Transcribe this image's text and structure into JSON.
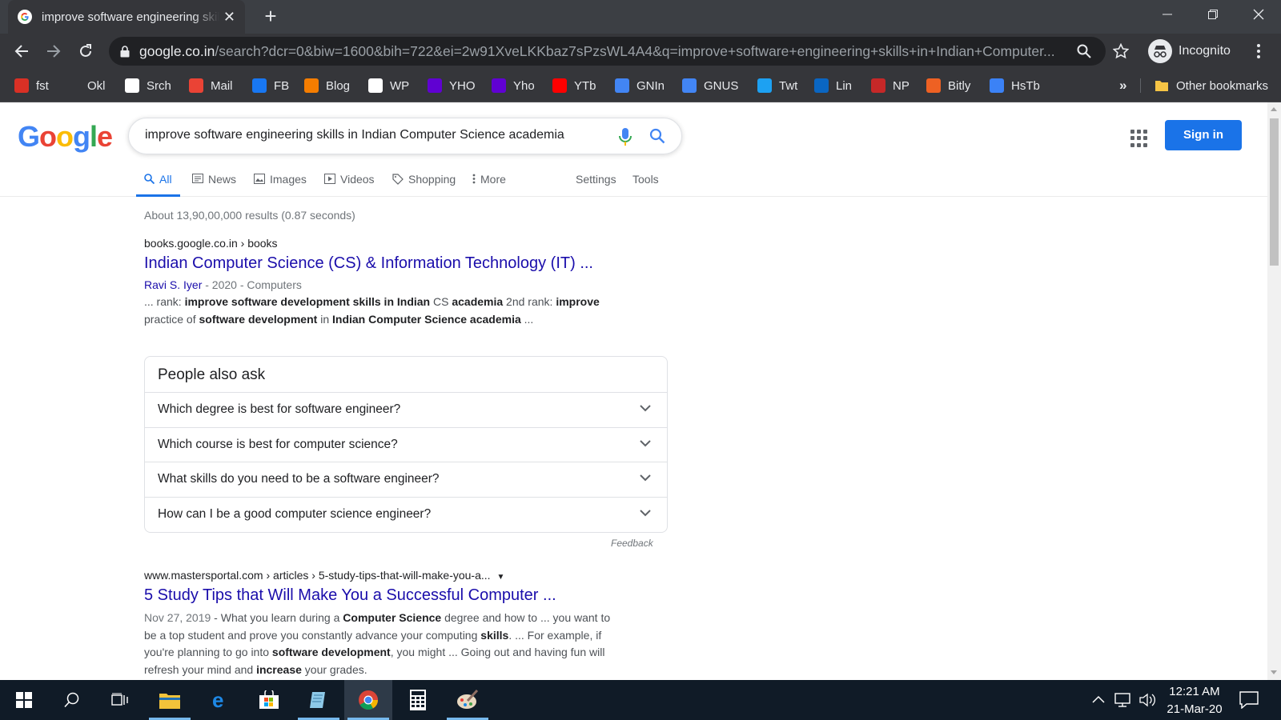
{
  "browser": {
    "tab_title": "improve software engineering skills in Indian Computer Science academia",
    "url_host": "google.co.in",
    "url_path": "/search?dcr=0&biw=1600&bih=722&ei=2w91XveLKKbaz7sPzsWL4A4&q=improve+software+engineering+skills+in+Indian+Computer...",
    "profile_label": "Incognito",
    "bookmarks": [
      {
        "label": "fst",
        "icon": "gauge-icon",
        "color": "#d93025"
      },
      {
        "label": "Okl",
        "icon": "blank-icon",
        "color": "#35363a"
      },
      {
        "label": "Srch",
        "icon": "google-icon",
        "color": "#ffffff"
      },
      {
        "label": "Mail",
        "icon": "gmail-icon",
        "color": "#ea4335"
      },
      {
        "label": "FB",
        "icon": "facebook-icon",
        "color": "#1877f2"
      },
      {
        "label": "Blog",
        "icon": "blogger-icon",
        "color": "#f57d00"
      },
      {
        "label": "WP",
        "icon": "wordpress-icon",
        "color": "#ffffff"
      },
      {
        "label": "YHO",
        "icon": "yahoo-icon",
        "color": "#6001d2"
      },
      {
        "label": "Yho",
        "icon": "yahoo-icon",
        "color": "#6001d2"
      },
      {
        "label": "YTb",
        "icon": "youtube-icon",
        "color": "#ff0000"
      },
      {
        "label": "GNIn",
        "icon": "google-news-icon",
        "color": "#4285f4"
      },
      {
        "label": "GNUS",
        "icon": "google-news-icon",
        "color": "#4285f4"
      },
      {
        "label": "Twt",
        "icon": "twitter-icon",
        "color": "#1da1f2"
      },
      {
        "label": "Lin",
        "icon": "linkedin-icon",
        "color": "#0a66c2"
      },
      {
        "label": "NP",
        "icon": "newspaper-icon",
        "color": "#c62828"
      },
      {
        "label": "Bitly",
        "icon": "bitly-icon",
        "color": "#ee6123"
      },
      {
        "label": "HsTb",
        "icon": "hashtag-icon",
        "color": "#3b82f6"
      }
    ],
    "overflow_label": "»",
    "other_bookmarks_label": "Other bookmarks"
  },
  "google": {
    "logo_text": "Google",
    "query": "improve software engineering skills in Indian Computer Science academia",
    "sign_in_label": "Sign in",
    "tabs": [
      {
        "label": "All",
        "icon": "search-icon"
      },
      {
        "label": "News",
        "icon": "news-icon"
      },
      {
        "label": "Images",
        "icon": "image-icon"
      },
      {
        "label": "Videos",
        "icon": "video-icon"
      },
      {
        "label": "Shopping",
        "icon": "tag-icon"
      },
      {
        "label": "More",
        "icon": "more-vert-icon"
      }
    ],
    "settings_label": "Settings",
    "tools_label": "Tools",
    "stats": "About 13,90,00,000 results (0.87 seconds)",
    "result1": {
      "cite": "books.google.co.in › books",
      "title": "Indian Computer Science (CS) & Information Technology (IT) ...",
      "author": "Ravi S. Iyer",
      "meta": " - 2020 - Computers",
      "snippet_line1": [
        {
          "t": "... rank: ",
          "b": false
        },
        {
          "t": "improve software development skills in Indian",
          "b": true
        },
        {
          "t": " CS ",
          "b": false
        },
        {
          "t": "academia",
          "b": true
        },
        {
          "t": " 2nd rank: ",
          "b": false
        },
        {
          "t": "improve",
          "b": true
        }
      ],
      "snippet_line2": [
        {
          "t": "practice of ",
          "b": false
        },
        {
          "t": "software development",
          "b": true
        },
        {
          "t": " in ",
          "b": false
        },
        {
          "t": "Indian Computer Science academia",
          "b": true
        },
        {
          "t": " ...",
          "b": false
        }
      ]
    },
    "people_also_ask": {
      "title": "People also ask",
      "questions": [
        "Which degree is best for software engineer?",
        "Which course is best for computer science?",
        "What skills do you need to be a software engineer?",
        "How can I be a good computer science engineer?"
      ],
      "feedback": "Feedback"
    },
    "result2": {
      "cite": "www.mastersportal.com › articles › 5-study-tips-that-will-make-you-a...",
      "cite_dropdown": "▼",
      "title": "5 Study Tips that Will Make You a Successful Computer ...",
      "date": "Nov 27, 2019",
      "snippet": [
        {
          "t": " - What you learn during a ",
          "b": false
        },
        {
          "t": "Computer Science",
          "b": true
        },
        {
          "t": " degree and how to ... you want to be a top student and prove you constantly advance your computing ",
          "b": false
        },
        {
          "t": "skills",
          "b": true
        },
        {
          "t": ". ... For example, if you're planning to go into ",
          "b": false
        },
        {
          "t": "software development",
          "b": true
        },
        {
          "t": ", you might ... Going out and having fun will refresh your mind and ",
          "b": false
        },
        {
          "t": "increase",
          "b": true
        },
        {
          "t": " your grades.",
          "b": false
        }
      ]
    }
  },
  "taskbar": {
    "time": "12:21 AM",
    "date": "21-Mar-20",
    "apps": [
      "start-icon",
      "search-icon",
      "task-view-icon",
      "file-explorer-icon",
      "edge-icon",
      "store-icon",
      "notepad-icon",
      "chrome-icon",
      "calculator-icon",
      "paint-icon"
    ]
  },
  "colors": {
    "link": "#1a0dab",
    "accent": "#1a73e8",
    "chrome_dark": "#35363a"
  }
}
